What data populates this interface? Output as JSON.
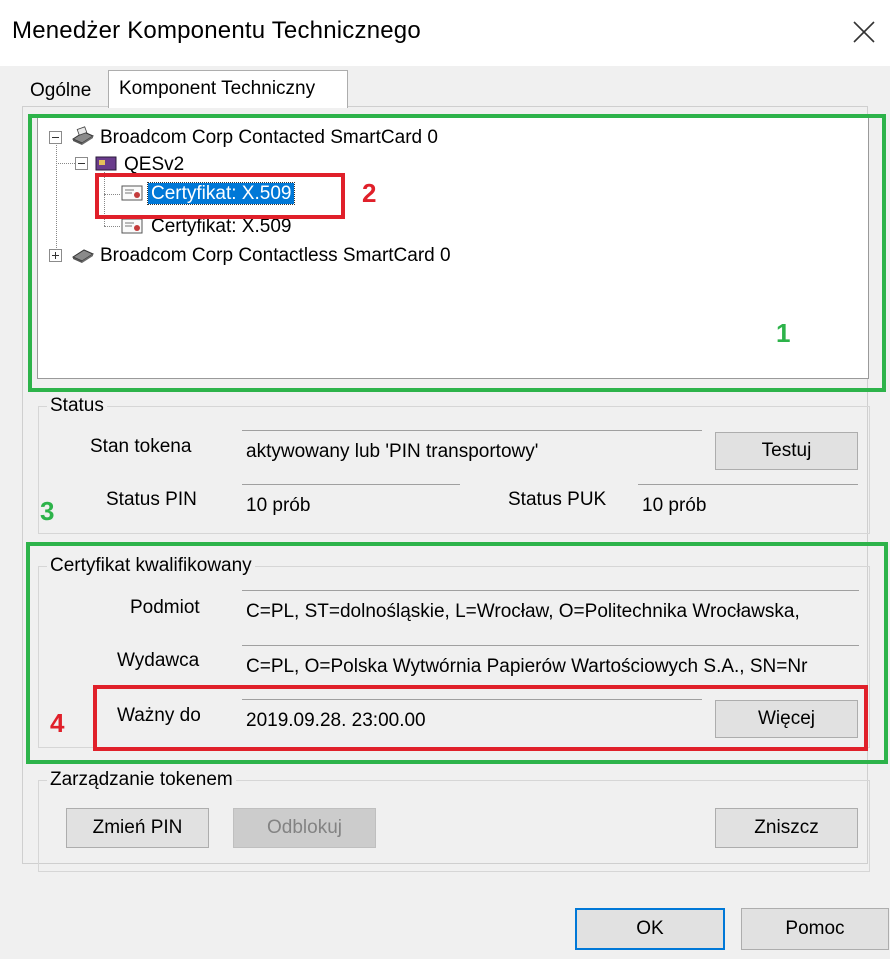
{
  "window": {
    "title": "Menedżer Komponentu Technicznego"
  },
  "tabs": [
    {
      "label": "Ogólne"
    },
    {
      "label": "Komponent Techniczny"
    }
  ],
  "tree": {
    "node1": "Broadcom Corp Contacted SmartCard 0",
    "node1_child": "QESv2",
    "cert1": "Certyfikat: X.509",
    "cert2": "Certyfikat: X.509",
    "node2": "Broadcom Corp Contactless SmartCard 0"
  },
  "status": {
    "legend": "Status",
    "token_state_label": "Stan tokena",
    "token_state_value": "aktywowany lub 'PIN transportowy'",
    "test_button": "Testuj",
    "pin_label": "Status PIN",
    "pin_value": "10 prób",
    "puk_label": "Status PUK",
    "puk_value": "10 prób"
  },
  "certificate": {
    "legend": "Certyfikat kwalifikowany",
    "subject_label": "Podmiot",
    "subject_value": "C=PL, ST=dolnośląskie, L=Wrocław, O=Politechnika Wrocławska, ",
    "issuer_label": "Wydawca",
    "issuer_value": "C=PL, O=Polska Wytwórnia Papierów Wartościowych S.A., SN=Nr",
    "valid_label": "Ważny do",
    "valid_value": "2019.09.28. 23:00.00",
    "more_button": "Więcej"
  },
  "management": {
    "legend": "Zarządzanie tokenem",
    "change_pin": "Zmień PIN",
    "unblock": "Odblokuj",
    "destroy": "Zniszcz"
  },
  "footer": {
    "ok": "OK",
    "help": "Pomoc"
  },
  "annotations": [
    "1",
    "2",
    "3",
    "4"
  ],
  "colors": {
    "annotation_green": "#2db34a",
    "annotation_red": "#e0202a",
    "selection_blue": "#0078d7"
  }
}
